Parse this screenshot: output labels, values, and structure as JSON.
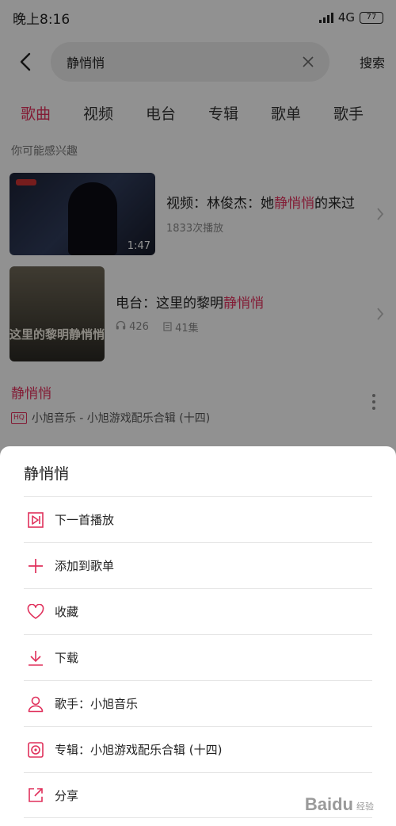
{
  "status_bar": {
    "time": "晚上8:16",
    "network": "4G",
    "battery": "77"
  },
  "search": {
    "query": "静悄悄",
    "action": "搜索"
  },
  "tabs": [
    {
      "label": "歌曲",
      "active": true
    },
    {
      "label": "视频",
      "active": false
    },
    {
      "label": "电台",
      "active": false
    },
    {
      "label": "专辑",
      "active": false
    },
    {
      "label": "歌单",
      "active": false
    },
    {
      "label": "歌手",
      "active": false
    }
  ],
  "suggestions": {
    "section_label": "你可能感兴趣",
    "video": {
      "title_prefix": "视频：林俊杰：她",
      "title_highlight": "静悄悄",
      "title_suffix": "的来过",
      "plays": "1833次播放",
      "duration": "1:47"
    },
    "radio": {
      "title_prefix": "电台：这里的黎明",
      "title_highlight": "静悄悄",
      "listens": "426",
      "episodes": "41集",
      "poster_text": "这里的黎明静悄悄"
    }
  },
  "song": {
    "title": "静悄悄",
    "quality": "HQ",
    "artist_album": "小旭音乐 - 小旭游戏配乐合辑 (十四)"
  },
  "sheet": {
    "title": "静悄悄",
    "items": [
      {
        "label": "下一首播放",
        "icon": "play-next-icon"
      },
      {
        "label": "添加到歌单",
        "icon": "plus-icon"
      },
      {
        "label": "收藏",
        "icon": "heart-icon"
      },
      {
        "label": "下载",
        "icon": "download-icon"
      },
      {
        "label": "歌手：小旭音乐",
        "icon": "user-icon"
      },
      {
        "label": "专辑：小旭游戏配乐合辑 (十四)",
        "icon": "album-icon"
      },
      {
        "label": "分享",
        "icon": "share-icon"
      }
    ]
  },
  "watermark": {
    "brand": "Baidu",
    "sub": "经验"
  },
  "colors": {
    "accent": "#e0315c"
  }
}
